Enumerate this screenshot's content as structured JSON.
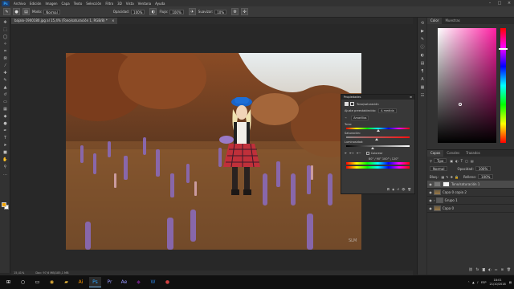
{
  "menubar": {
    "logo": "Ps",
    "items": [
      "Archivo",
      "Edición",
      "Imagen",
      "Capa",
      "Texto",
      "Selección",
      "Filtro",
      "3D",
      "Vista",
      "Ventana",
      "Ayuda"
    ]
  },
  "options_bar": {
    "mode_label": "Modo:",
    "mode_value": "Normal",
    "opacity_label": "Opacidad:",
    "opacity_value": "100%",
    "flow_label": "Flujo:",
    "flow_value": "100%",
    "smooth_label": "Suavizar:",
    "smooth_value": "10%"
  },
  "document": {
    "tab_title": "bajalo-1900180.jpg al 15,4% (Tono/saturación 1, RGB/8) *"
  },
  "status_bar": {
    "zoom": "15,41%",
    "doc_size": "Doc: 97,6 MB/185,1 MB"
  },
  "properties_panel": {
    "title": "Propiedades",
    "subtitle": "Tono/saturación",
    "preset_label": "Ajuste preestablecido:",
    "preset_value": "A medida",
    "channel_value": "Amarillos",
    "hue_label": "Tono:",
    "saturation_label": "Saturación:",
    "lightness_label": "Luminosidad:",
    "colorize_label": "Colorear",
    "range_readout": "80° / 90°   100° \\ 120°",
    "hue_value": 0.5,
    "saturation_value": 0.48,
    "lightness_value": 0.42
  },
  "color_panel": {
    "tabs": [
      "Color",
      "Muestras"
    ],
    "selected_hue": "#ff1fa3"
  },
  "layers_panel": {
    "tabs": [
      "Capas",
      "Canales",
      "Trazados"
    ],
    "filter_label": "Tipo",
    "blend_mode": "Normal",
    "opacity_label": "Opacidad:",
    "opacity_value": "100%",
    "lock_label": "Bloq.:",
    "fill_label": "Relleno:",
    "fill_value": "100%",
    "layers": [
      {
        "name": "Tono/saturación 1",
        "kind": "adjust",
        "selected": true
      },
      {
        "name": "Capa 0 copia 2",
        "kind": "photo",
        "selected": false
      },
      {
        "name": "Grupo 1",
        "kind": "folder",
        "selected": false
      },
      {
        "name": "Capa 0",
        "kind": "photo",
        "selected": false
      }
    ]
  },
  "taskbar": {
    "language": "ESP",
    "time": "18:01",
    "date": "21/10/2018"
  },
  "colors": {
    "accent": "#31a8ff",
    "foreground_swatch": "#f2a400",
    "background_swatch": "#ffffff"
  }
}
